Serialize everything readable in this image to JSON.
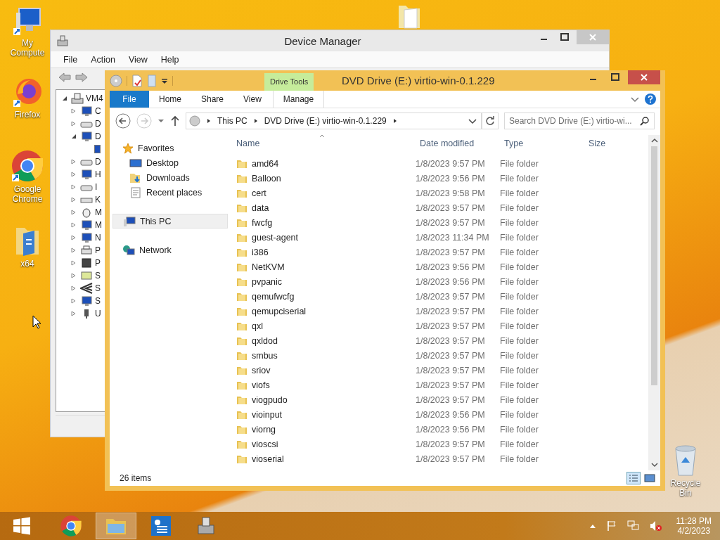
{
  "desktop_icons": [
    {
      "kind": "computer",
      "label": "My Compute"
    },
    {
      "kind": "firefox",
      "label": "Firefox"
    },
    {
      "kind": "chrome",
      "label": "Google Chrome"
    },
    {
      "kind": "folder",
      "label": "x64"
    },
    {
      "kind": "recycle",
      "label": "Recycle Bin"
    }
  ],
  "device_manager": {
    "title": "Device Manager",
    "menu": [
      "File",
      "Action",
      "View",
      "Help"
    ],
    "tree": {
      "root": "VM4",
      "expanded": true,
      "items": [
        {
          "label": "C",
          "kind": "computer",
          "expanded": false
        },
        {
          "label": "D",
          "kind": "drive",
          "expanded": false
        },
        {
          "label": "D",
          "kind": "display",
          "expanded": true
        },
        {
          "label": "D",
          "kind": "dvd",
          "expanded": false
        },
        {
          "label": "H",
          "kind": "hid",
          "expanded": false
        },
        {
          "label": "I",
          "kind": "ide",
          "expanded": false
        },
        {
          "label": "K",
          "kind": "keyboard",
          "expanded": false
        },
        {
          "label": "M",
          "kind": "mouse",
          "expanded": false
        },
        {
          "label": "M",
          "kind": "monitor",
          "expanded": false
        },
        {
          "label": "N",
          "kind": "network",
          "expanded": false
        },
        {
          "label": "P",
          "kind": "printer",
          "expanded": false
        },
        {
          "label": "P",
          "kind": "processor",
          "expanded": false
        },
        {
          "label": "S",
          "kind": "sound",
          "expanded": false
        },
        {
          "label": "S",
          "kind": "storage",
          "expanded": false
        },
        {
          "label": "S",
          "kind": "monitor",
          "expanded": false
        },
        {
          "label": "U",
          "kind": "usb",
          "expanded": false
        }
      ]
    }
  },
  "explorer": {
    "title": "DVD Drive (E:) virtio-win-0.1.229",
    "ribbon": {
      "file_tab": "File",
      "tabs": [
        "Home",
        "Share",
        "View"
      ],
      "context_group": "Drive Tools",
      "context_tab": "Manage"
    },
    "address": [
      "This PC",
      "DVD Drive (E:) virtio-win-0.1.229"
    ],
    "search": {
      "placeholder": "Search DVD Drive (E:) virtio-wi..."
    },
    "nav": [
      {
        "kind": "favorites",
        "label": "Favorites",
        "selected": false,
        "children": [
          {
            "kind": "desktop",
            "label": "Desktop",
            "selected": false
          },
          {
            "kind": "downloads",
            "label": "Downloads",
            "selected": false
          },
          {
            "kind": "recent",
            "label": "Recent places",
            "selected": false
          }
        ]
      },
      {
        "kind": "pc",
        "label": "This PC",
        "selected": true
      },
      {
        "kind": "network",
        "label": "Network",
        "selected": false
      }
    ],
    "columns": [
      "Name",
      "Date modified",
      "Type",
      "Size"
    ],
    "rows": [
      {
        "name": "amd64",
        "date": "1/8/2023 9:57 PM",
        "type": "File folder"
      },
      {
        "name": "Balloon",
        "date": "1/8/2023 9:56 PM",
        "type": "File folder"
      },
      {
        "name": "cert",
        "date": "1/8/2023 9:58 PM",
        "type": "File folder"
      },
      {
        "name": "data",
        "date": "1/8/2023 9:57 PM",
        "type": "File folder"
      },
      {
        "name": "fwcfg",
        "date": "1/8/2023 9:57 PM",
        "type": "File folder"
      },
      {
        "name": "guest-agent",
        "date": "1/8/2023 11:34 PM",
        "type": "File folder"
      },
      {
        "name": "i386",
        "date": "1/8/2023 9:57 PM",
        "type": "File folder"
      },
      {
        "name": "NetKVM",
        "date": "1/8/2023 9:56 PM",
        "type": "File folder"
      },
      {
        "name": "pvpanic",
        "date": "1/8/2023 9:56 PM",
        "type": "File folder"
      },
      {
        "name": "qemufwcfg",
        "date": "1/8/2023 9:57 PM",
        "type": "File folder"
      },
      {
        "name": "qemupciserial",
        "date": "1/8/2023 9:57 PM",
        "type": "File folder"
      },
      {
        "name": "qxl",
        "date": "1/8/2023 9:57 PM",
        "type": "File folder"
      },
      {
        "name": "qxldod",
        "date": "1/8/2023 9:57 PM",
        "type": "File folder"
      },
      {
        "name": "smbus",
        "date": "1/8/2023 9:57 PM",
        "type": "File folder"
      },
      {
        "name": "sriov",
        "date": "1/8/2023 9:57 PM",
        "type": "File folder"
      },
      {
        "name": "viofs",
        "date": "1/8/2023 9:57 PM",
        "type": "File folder"
      },
      {
        "name": "viogpudo",
        "date": "1/8/2023 9:57 PM",
        "type": "File folder"
      },
      {
        "name": "vioinput",
        "date": "1/8/2023 9:56 PM",
        "type": "File folder"
      },
      {
        "name": "viorng",
        "date": "1/8/2023 9:56 PM",
        "type": "File folder"
      },
      {
        "name": "vioscsi",
        "date": "1/8/2023 9:57 PM",
        "type": "File folder"
      },
      {
        "name": "vioserial",
        "date": "1/8/2023 9:57 PM",
        "type": "File folder"
      }
    ],
    "status": "26 items"
  },
  "taskbar": {
    "apps": [
      {
        "kind": "chrome",
        "selected": false
      },
      {
        "kind": "explorer",
        "selected": true
      },
      {
        "kind": "server-manager",
        "selected": false
      },
      {
        "kind": "device-manager",
        "selected": false
      }
    ],
    "volume_muted": true,
    "time": "11:28 PM",
    "date": "4/2/2023"
  }
}
